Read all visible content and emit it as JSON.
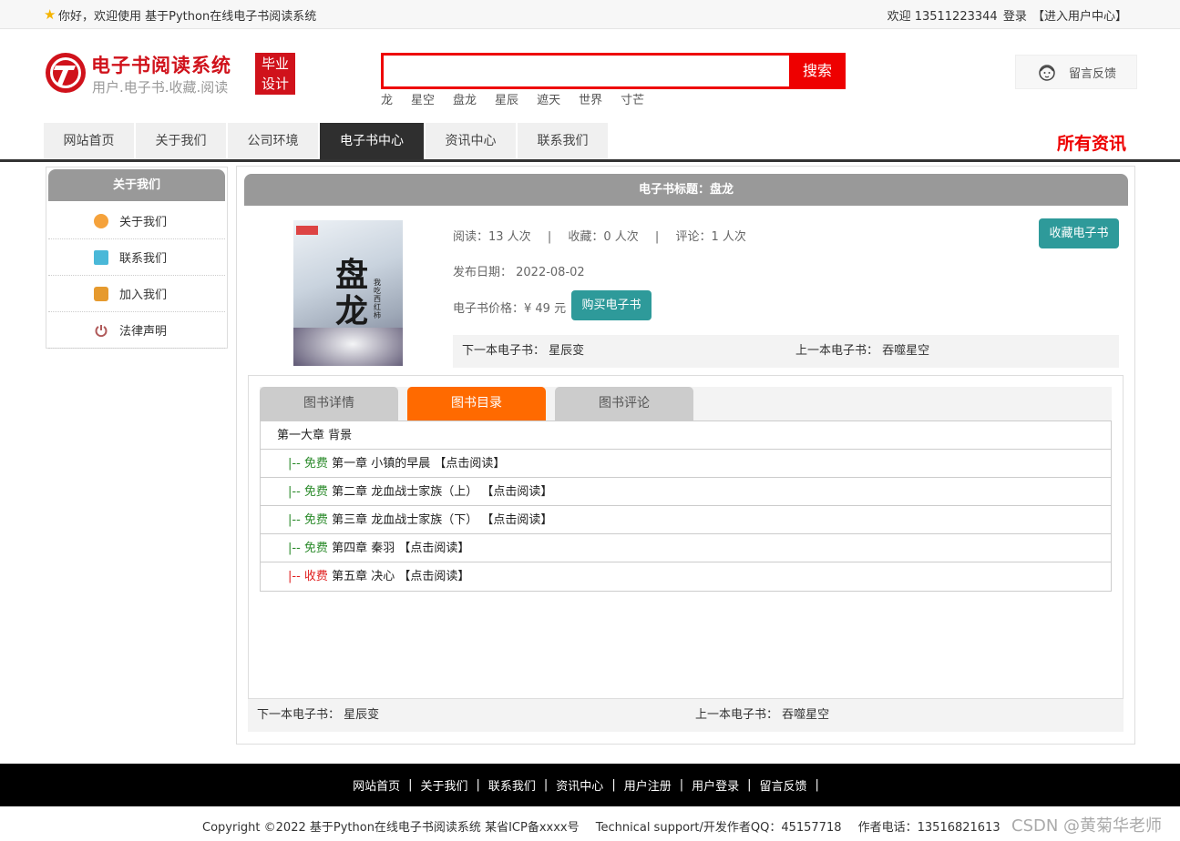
{
  "topbar": {
    "welcome": "你好，欢迎使用 基于Python在线电子书阅读系统",
    "user_greeting": "欢迎 13511223344",
    "login": "登录",
    "user_center": "【进入用户中心】"
  },
  "header": {
    "logo_title": "电子书阅读系统",
    "logo_subtitle": "用户.电子书.收藏.阅读",
    "badge_line1": "毕业",
    "badge_line2": "设计",
    "search_placeholder": "",
    "search_button": "搜索",
    "hotwords": [
      "龙",
      "星空",
      "盘龙",
      "星辰",
      "遮天",
      "世界",
      "寸芒"
    ],
    "feedback": "留言反馈"
  },
  "nav": {
    "items": [
      "网站首页",
      "关于我们",
      "公司环境",
      "电子书中心",
      "资讯中心",
      "联系我们"
    ],
    "active_index": 3,
    "all_news": "所有资讯"
  },
  "sidebar": {
    "title": "关于我们",
    "items": [
      {
        "label": "关于我们",
        "icon": "orange-circle-icon"
      },
      {
        "label": "联系我们",
        "icon": "clipboard-icon"
      },
      {
        "label": "加入我们",
        "icon": "lock-icon"
      },
      {
        "label": "法律声明",
        "icon": "power-icon"
      }
    ]
  },
  "book": {
    "header": "电子书标题：盘龙",
    "cover_title": "盘龙",
    "cover_author": "我吃西红柿",
    "read_label": "阅读：13 人次",
    "fav_label": "收藏：0 人次",
    "comment_label": "评论：1 人次",
    "separator": "|",
    "pubdate": "发布日期：  2022-08-02",
    "price": "电子书价格：¥ 49 元",
    "buy_button": "购买电子书",
    "fav_button": "收藏电子书",
    "next_book": "下一本电子书：  星辰变",
    "prev_book": "上一本电子书：  吞噬星空"
  },
  "tabs": {
    "items": [
      "图书详情",
      "图书目录",
      "图书评论"
    ],
    "active_index": 1
  },
  "chapters": {
    "volume": "第一大章 背景",
    "rows": [
      {
        "prefix": "|--",
        "status": "免费",
        "title": "第一章 小镇的早晨",
        "action": "【点击阅读】",
        "paid": false
      },
      {
        "prefix": "|--",
        "status": "免费",
        "title": "第二章 龙血战士家族（上）",
        "action": "【点击阅读】",
        "paid": false
      },
      {
        "prefix": "|--",
        "status": "免费",
        "title": "第三章 龙血战士家族（下）",
        "action": "【点击阅读】",
        "paid": false
      },
      {
        "prefix": "|--",
        "status": "免费",
        "title": "第四章 秦羽",
        "action": "【点击阅读】",
        "paid": false
      },
      {
        "prefix": "|--",
        "status": "收费",
        "title": "第五章 决心",
        "action": "【点击阅读】",
        "paid": true
      }
    ]
  },
  "bottom_nav": {
    "next_book": "下一本电子书：  星辰变",
    "prev_book": "上一本电子书：  吞噬星空"
  },
  "footer": {
    "links": [
      "网站首页",
      "关于我们",
      "联系我们",
      "资讯中心",
      "用户注册",
      "用户登录",
      "留言反馈"
    ],
    "pipe": "|",
    "copyright": "Copyright ©2022 基于Python在线电子书阅读系统 某省ICP备xxxx号",
    "support": "Technical support/开发作者QQ：45157718",
    "phone": "作者电话：13516821613",
    "watermark": "CSDN @黄菊华老师"
  },
  "colors": {
    "brand_red": "#d0121b",
    "search_red": "#ee0000",
    "teal": "#2e9a9a",
    "tab_orange": "#ff6a00",
    "free_green": "#2a8a2a",
    "paid_red": "#e02020"
  }
}
